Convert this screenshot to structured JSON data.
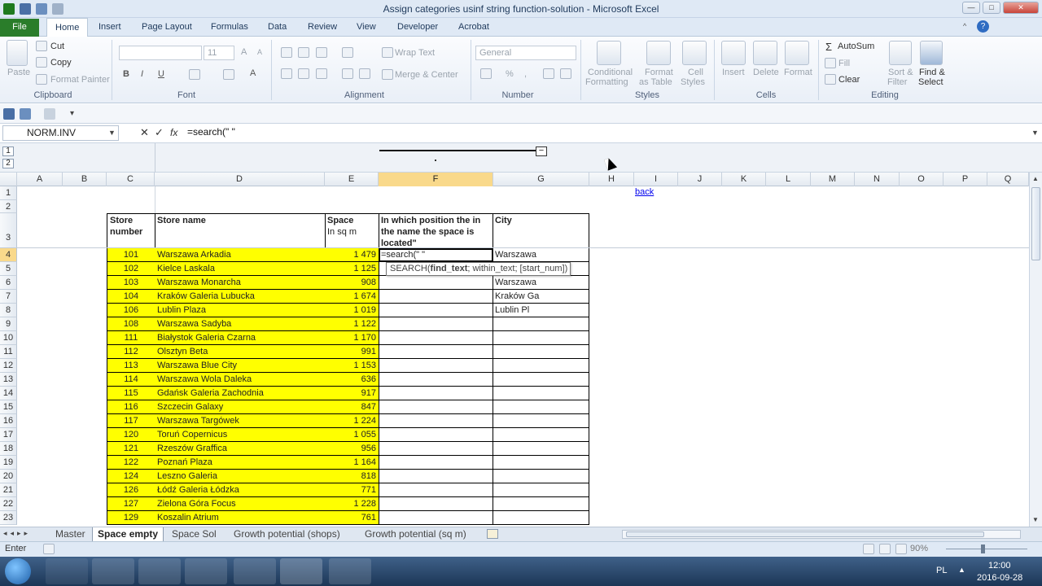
{
  "window": {
    "title": "Assign categories usinf string function-solution  -  Microsoft Excel"
  },
  "ribbon": {
    "tabs": [
      "File",
      "Home",
      "Insert",
      "Page Layout",
      "Formulas",
      "Data",
      "Review",
      "View",
      "Developer",
      "Acrobat"
    ],
    "clipboard": {
      "paste": "Paste",
      "cut": "Cut",
      "copy": "Copy",
      "format_painter": "Format Painter",
      "label": "Clipboard"
    },
    "font": {
      "name": "",
      "size": "11",
      "label": "Font",
      "bold": "B",
      "italic": "I",
      "underline": "U"
    },
    "alignment": {
      "wrap": "Wrap Text",
      "merge": "Merge & Center",
      "label": "Alignment"
    },
    "number": {
      "format": "General",
      "label": "Number"
    },
    "styles": {
      "cond1": "Conditional",
      "cond2": "Formatting",
      "fmt1": "Format",
      "fmt2": "as Table",
      "cell1": "Cell",
      "cell2": "Styles",
      "label": "Styles"
    },
    "cells": {
      "insert": "Insert",
      "delete": "Delete",
      "format": "Format",
      "label": "Cells"
    },
    "editing": {
      "autosum": "AutoSum",
      "fill": "Fill",
      "clear": "Clear",
      "sort1": "Sort &",
      "sort2": "Filter",
      "find1": "Find &",
      "find2": "Select",
      "label": "Editing"
    }
  },
  "formula_bar": {
    "name_box": "NORM.INV",
    "fx": "fx",
    "formula": "=search(\" \""
  },
  "outline": {
    "level1": "1",
    "level2": "2"
  },
  "columns": [
    "A",
    "B",
    "C",
    "D",
    "E",
    "F",
    "G",
    "H",
    "I",
    "J",
    "K",
    "L",
    "M",
    "N",
    "O",
    "P",
    "Q"
  ],
  "rows": [
    "1",
    "2",
    "3",
    "4",
    "5",
    "6",
    "7",
    "8",
    "9",
    "10",
    "11",
    "12",
    "13",
    "14",
    "15",
    "16",
    "17",
    "18",
    "19",
    "20",
    "21",
    "22",
    "23"
  ],
  "sheet": {
    "back_link": "back",
    "headers": {
      "store_number": "Store number",
      "store_name": "Store name",
      "space": "Space",
      "space_unit": "In sq m",
      "position": "In which position the in the name the space is located\"",
      "city": "City"
    },
    "active_cell_text": "=search(\" \"",
    "tooltip": "SEARCH(find_text; within_text; [start_num])",
    "stores": [
      {
        "no": "101",
        "name": "Warszawa Arkadia",
        "space": "1 479",
        "city": "Warszawa"
      },
      {
        "no": "102",
        "name": "Kielce Laskala",
        "space": "1 125",
        "city": ""
      },
      {
        "no": "103",
        "name": "Warszawa Monarcha",
        "space": "908",
        "city": "Warszawa"
      },
      {
        "no": "104",
        "name": "Kraków Galeria Lubucka",
        "space": "1 674",
        "city": "Kraków Ga"
      },
      {
        "no": "106",
        "name": "Lublin Plaza",
        "space": "1 019",
        "city": "Lublin Pl"
      },
      {
        "no": "108",
        "name": "Warszawa Sadyba",
        "space": "1 122",
        "city": ""
      },
      {
        "no": "111",
        "name": "Białystok Galeria Czarna",
        "space": "1 170",
        "city": ""
      },
      {
        "no": "112",
        "name": "Olsztyn Beta",
        "space": "991",
        "city": ""
      },
      {
        "no": "113",
        "name": "Warszawa Blue City",
        "space": "1 153",
        "city": ""
      },
      {
        "no": "114",
        "name": "Warszawa Wola Daleka",
        "space": "636",
        "city": ""
      },
      {
        "no": "115",
        "name": "Gdańsk Galeria Zachodnia",
        "space": "917",
        "city": ""
      },
      {
        "no": "116",
        "name": "Szczecin Galaxy",
        "space": "847",
        "city": ""
      },
      {
        "no": "117",
        "name": "Warszawa Targówek",
        "space": "1 224",
        "city": ""
      },
      {
        "no": "120",
        "name": "Toruń Copernicus",
        "space": "1 055",
        "city": ""
      },
      {
        "no": "121",
        "name": "Rzeszów Graffica",
        "space": "956",
        "city": ""
      },
      {
        "no": "122",
        "name": "Poznań Plaza",
        "space": "1 164",
        "city": ""
      },
      {
        "no": "124",
        "name": "Leszno Galeria",
        "space": "818",
        "city": ""
      },
      {
        "no": "126",
        "name": "Łódź Galeria Łódzka",
        "space": "771",
        "city": ""
      },
      {
        "no": "127",
        "name": "Zielona Góra Focus",
        "space": "1 228",
        "city": ""
      },
      {
        "no": "129",
        "name": "Koszalin Atrium",
        "space": "761",
        "city": ""
      }
    ]
  },
  "sheet_tabs": [
    "Master",
    "Space empty",
    "Space Sol",
    "Growth potential (shops)",
    "Growth potential (sq m)"
  ],
  "status": {
    "mode": "Enter",
    "zoom": "90%"
  },
  "taskbar": {
    "lang": "PL",
    "time": "12:00",
    "date": "2016-09-28"
  },
  "colors": {
    "accent_green": "#2a7d2a",
    "highlight": "#ffff00",
    "selected_header": "#f9d98b"
  }
}
